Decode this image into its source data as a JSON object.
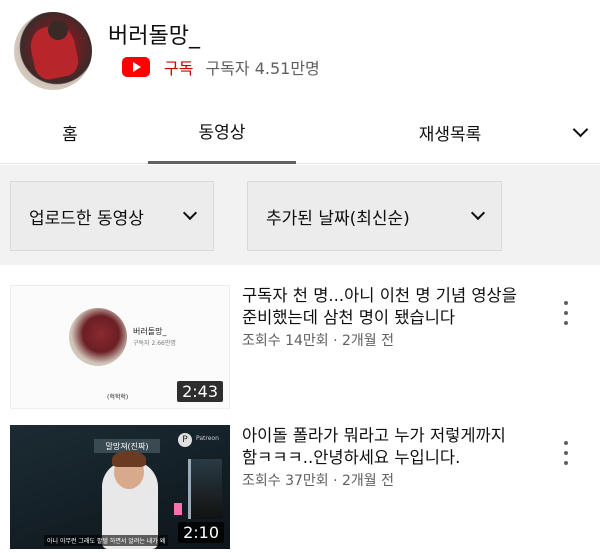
{
  "channel": {
    "name": "버러돌망_",
    "subscribe_label": "구독",
    "subscriber_count": "구독자 4.51만명",
    "accent_color": "#ff0000"
  },
  "tabs": [
    {
      "label": "홈",
      "selected": false
    },
    {
      "label": "동영상",
      "selected": true
    },
    {
      "label": "재생목록",
      "selected": false
    }
  ],
  "filters": {
    "type": "업로드한 동영상",
    "sort": "추가된 날짜(최신순)"
  },
  "videos": [
    {
      "title": "구독자 천 명...아니 이천 명 기념 영상을 준비했는데 삼천 명이 됐습니다",
      "info": "조회수 14만회 · 2개월 전",
      "duration": "2:43",
      "thumb_name": "버러돌망_",
      "thumb_sub": "구독자 2.66만명",
      "thumb_foot": "(헉헉헉)"
    },
    {
      "title": "아이돌 폴라가 뭐라고 누가 저렇게까지 함ㅋㅋㅋ..안녕하세요 누입니다.",
      "info": "조회수 37만회 · 2개월 전",
      "duration": "2:10",
      "thumb_banner": "말망져(진짜)",
      "thumb_logo": "Patreon",
      "thumb_caption": "아니 아무런 그래도 팔텔 하면서 알려는 내가 왜"
    }
  ]
}
